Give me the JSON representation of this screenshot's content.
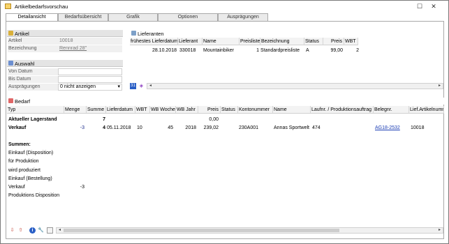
{
  "window": {
    "title": "Artikelbedarfsvorschau"
  },
  "tabs": [
    "Detailansicht",
    "Bedarfsübersicht",
    "Grafik",
    "Optionen",
    "Ausprägungen"
  ],
  "artikel": {
    "header": "Artikel",
    "fields": [
      {
        "label": "Artikel",
        "value": "10018"
      },
      {
        "label": "Bezeichnung",
        "value": "Rennrad 28\""
      }
    ]
  },
  "auswahl": {
    "header": "Auswahl",
    "von_label": "Von Datum",
    "von_value": "",
    "bis_label": "Bis Datum",
    "bis_value": "",
    "auspr_label": "Ausprägungen",
    "auspr_value": "0 nicht anzeigen"
  },
  "lieferanten": {
    "header": "Lieferanten",
    "columns": [
      "frühestes Lieferdatum",
      "Lieferant",
      "Name",
      "Preisliste",
      "Bezeichnung",
      "Status",
      "Preis",
      "WBT"
    ],
    "row": [
      "28.10.2018",
      "330018",
      "Mountainbiker",
      "1",
      "Standardpreisliste",
      "A",
      "99,00",
      "2"
    ],
    "footer_badge": "31"
  },
  "bedarf": {
    "header": "Bedarf",
    "columns": [
      "Typ",
      "Menge",
      "Summe",
      "Lieferdatum",
      "WBT",
      "WB Woche",
      "WB Jahr",
      "Preis",
      "Status",
      "Kontonummer",
      "Name",
      "Laufnr. / Produktionsauftrag",
      "Belegnr.",
      "Lief.Artikelnummer"
    ],
    "lagerstand": {
      "typ": "Aktueller Lagerstand",
      "summe": "7",
      "preis": "0,00"
    },
    "verkauf": {
      "typ": "Verkauf",
      "menge": "-3",
      "summe": "4",
      "lieferdatum": "05.11.2018",
      "wbt": "10",
      "wbwoche": "45",
      "wbjahr": "2018",
      "preis": "239,02",
      "kontonummer": "230A001",
      "name": "Annas Sportwelt",
      "laufnr": "474",
      "belegnr": "AG18-2532",
      "liefart": "10018"
    },
    "summen_title": "Summen:",
    "summen": [
      {
        "label": "Einkauf (Disposition)",
        "value": ""
      },
      {
        "label": "für Produktion",
        "value": ""
      },
      {
        "label": "wird produziert",
        "value": ""
      },
      {
        "label": "Einkauf (Bestellung)",
        "value": ""
      },
      {
        "label": "Verkauf",
        "value": "-3"
      },
      {
        "label": "Produktions Disposition",
        "value": ""
      }
    ]
  }
}
